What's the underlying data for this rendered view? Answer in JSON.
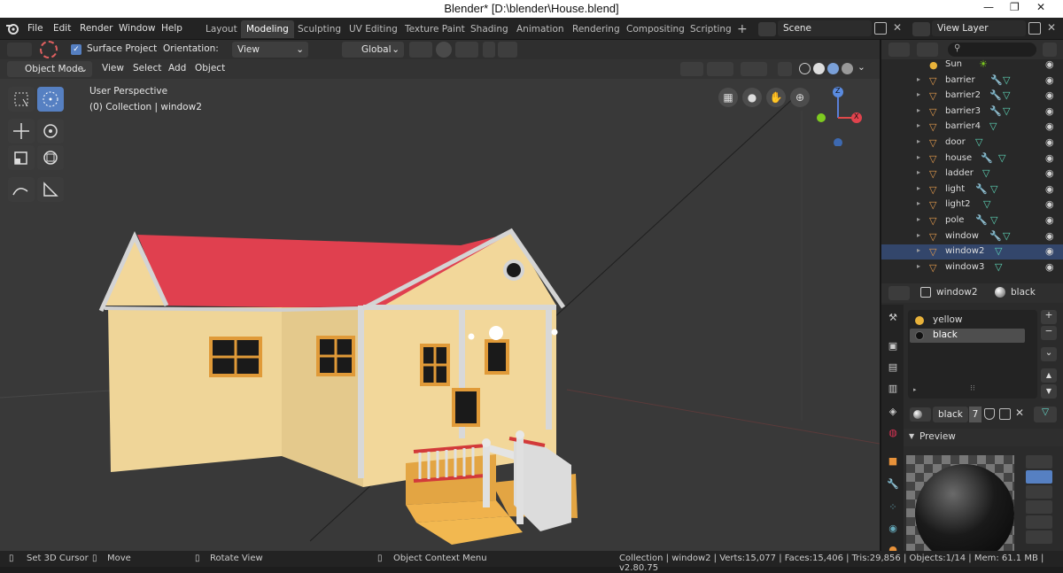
{
  "title": "Blender* [D:\\blender\\House.blend]",
  "window_controls": [
    "—",
    "❐",
    "✕"
  ],
  "menu": [
    "File",
    "Edit",
    "Render",
    "Window",
    "Help"
  ],
  "workspaces": [
    "Layout",
    "Modeling",
    "Sculpting",
    "UV Editing",
    "Texture Paint",
    "Shading",
    "Animation",
    "Rendering",
    "Compositing",
    "Scripting"
  ],
  "active_workspace": "Modeling",
  "scene": "Scene",
  "view_layer": "View Layer",
  "tool_header": {
    "surface_project": "Surface Project",
    "orientation_label": "Orientation:",
    "orientation_value": "View",
    "transform_orientation": "Global"
  },
  "viewport_header": {
    "mode": "Object Mode",
    "menus": [
      "View",
      "Select",
      "Add",
      "Object"
    ]
  },
  "viewport": {
    "perspective": "User Perspective",
    "collection_info": "(0) Collection | window2"
  },
  "gizmo": {
    "z": "Z",
    "x": "X"
  },
  "outliner": {
    "search_placeholder": "",
    "items": [
      {
        "name": "Sun",
        "type": "light"
      },
      {
        "name": "barrier",
        "type": "mesh",
        "modifier": true
      },
      {
        "name": "barrier2",
        "type": "mesh",
        "modifier": true
      },
      {
        "name": "barrier3",
        "type": "mesh",
        "modifier": true
      },
      {
        "name": "barrier4",
        "type": "mesh",
        "modifier": false
      },
      {
        "name": "door",
        "type": "mesh",
        "modifier": false
      },
      {
        "name": "house",
        "type": "mesh",
        "modifier": true
      },
      {
        "name": "ladder",
        "type": "mesh",
        "modifier": false
      },
      {
        "name": "light",
        "type": "mesh",
        "modifier": true
      },
      {
        "name": "light2",
        "type": "mesh",
        "modifier": false
      },
      {
        "name": "pole",
        "type": "mesh",
        "modifier": true
      },
      {
        "name": "window",
        "type": "mesh",
        "modifier": true
      },
      {
        "name": "window2",
        "type": "mesh",
        "modifier": false,
        "selected": true
      },
      {
        "name": "window3",
        "type": "mesh",
        "modifier": false
      }
    ]
  },
  "properties": {
    "object_name": "window2",
    "material_name": "black",
    "slots": [
      "yellow",
      "black"
    ],
    "active_slot": "black",
    "material_field": "black",
    "user_count": "7",
    "preview_label": "Preview"
  },
  "status": {
    "set_cursor": "Set 3D Cursor",
    "move": "Move",
    "rotate": "Rotate View",
    "context": "Object Context Menu",
    "stats": "Collection | window2 | Verts:15,077 | Faces:15,406 | Tris:29,856 | Objects:1/14 | Mem: 61.1 MB | v2.80.75"
  },
  "colors": {
    "accent": "#5680c2",
    "roof": "#e0404f",
    "wall": "#efd598",
    "trim": "#d9d9d9",
    "step": "#e3a543",
    "window_frame": "#e09a38",
    "selected_row": "#33466b"
  }
}
